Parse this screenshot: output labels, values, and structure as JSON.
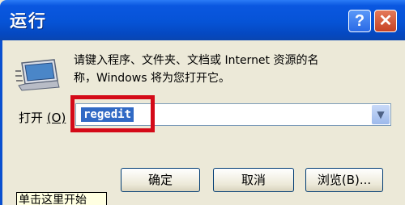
{
  "window": {
    "title": "运行",
    "help_glyph": "?",
    "close_glyph": "✕"
  },
  "dialog": {
    "icon": "run-dialog-icon",
    "description_line1": "请键入程序、文件夹、文档或 Internet 资源的名",
    "description_line2": "称，Windows 将为您打开它。",
    "open_label": "打开",
    "open_label_hotkey": "(O)",
    "combo_value": "regedit",
    "combo_arrow_glyph": "▼"
  },
  "buttons": {
    "ok": "确定",
    "cancel": "取消",
    "browse": "浏览(B)..."
  },
  "tooltip_fragment": "单击这里开始",
  "colors": {
    "titlebar": "#0653d6",
    "highlight_box": "#d40a18",
    "selection": "#316ac5",
    "dialog_bg": "#ece9d8"
  }
}
